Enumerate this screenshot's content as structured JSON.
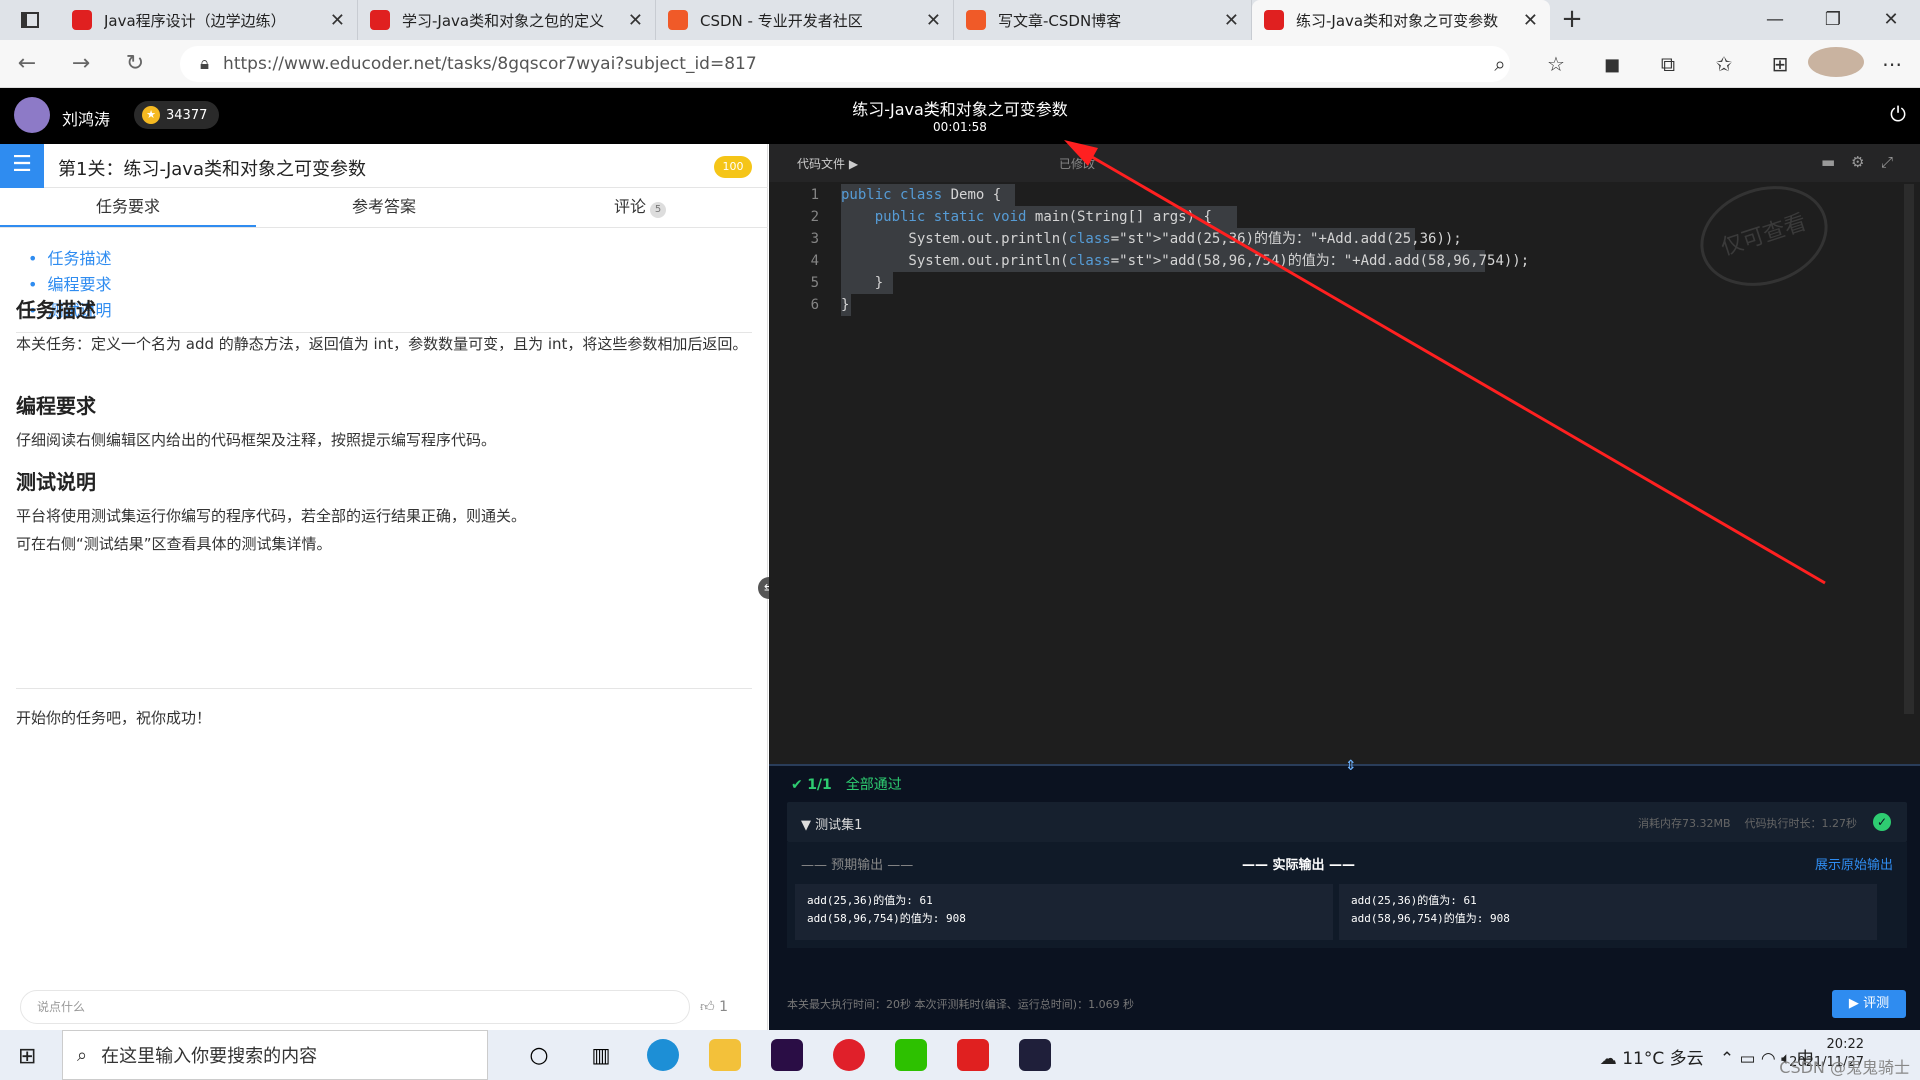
{
  "browser": {
    "tabs": [
      {
        "title": "Java程序设计（边学边练）",
        "favicon_color": "#e02020"
      },
      {
        "title": "学习-Java类和对象之包的定义",
        "favicon_color": "#e02020"
      },
      {
        "title": "CSDN - 专业开发者社区",
        "favicon_color": "#f05a28"
      },
      {
        "title": "写文章-CSDN博客",
        "favicon_color": "#f05a28"
      },
      {
        "title": "练习-Java类和对象之可变参数",
        "favicon_color": "#e02020",
        "active": true
      }
    ],
    "url": "https://www.educoder.net/tasks/8gqscor7wyai?subject_id=817"
  },
  "header": {
    "username": "刘鸿涛",
    "coins": "34377",
    "title": "练习-Java类和对象之可变参数",
    "timer": "00:01:58"
  },
  "left": {
    "level_title": "第1关：练习-Java类和对象之可变参数",
    "score": "100",
    "tabs": [
      "任务要求",
      "参考答案",
      "评论"
    ],
    "comment_count": "5",
    "toc": [
      "任务描述",
      "编程要求",
      "测试说明"
    ],
    "sections": {
      "task_heading": "任务描述",
      "task_text": "本关任务：定义一个名为 add 的静态方法，返回值为 int，参数数量可变，且为 int，将这些参数相加后返回。",
      "req_heading": "编程要求",
      "req_text": "仔细阅读右侧编辑区内给出的代码框架及注释，按照提示编写程序代码。",
      "test_heading": "测试说明",
      "test_text_1": "平台将使用测试集运行你编写的程序代码，若全部的运行结果正确，则通关。",
      "test_text_2": "可在右侧“测试结果”区查看具体的测试集详情。",
      "closing": "开始你的任务吧，祝你成功！"
    },
    "comment_placeholder": "说点什么",
    "likes": "1"
  },
  "editor": {
    "files_label": "代码文件",
    "modified_label": "已修改",
    "watermark": "仅可查看",
    "line_numbers": [
      "1",
      "2",
      "3",
      "4",
      "5",
      "6"
    ],
    "code_lines": [
      "public class Demo {",
      "    public static void main(String[] args) {",
      "        System.out.println(\"add(25,36)的值为：\"+Add.add(25,36));",
      "        System.out.println(\"add(58,96,754)的值为：\"+Add.add(58,96,754));",
      "    }",
      "}"
    ]
  },
  "results": {
    "pass_count": "1/1",
    "pass_text": "全部通过",
    "set_name": "测试集1",
    "memory": "消耗内存73.32MB",
    "exec_time": "代码执行时长：1.27秒",
    "expected_label": "—— 预期输出 ——",
    "actual_label": "—— 实际输出 ——",
    "show_raw": "展示原始输出",
    "expected_lines": [
      "add(25,36)的值为: 61",
      "add(58,96,754)的值为: 908"
    ],
    "actual_lines": [
      "add(25,36)的值为: 61",
      "add(58,96,754)的值为: 908"
    ],
    "footer": "本关最大执行时间：20秒    本次评测耗时(编译、运行总时间)：1.069 秒",
    "run_button": "评测"
  },
  "taskbar": {
    "search_placeholder": "在这里输入你要搜索的内容",
    "weather": "11°C 多云",
    "time": "20:22",
    "date": "2021/11/27",
    "ime": "中",
    "watermark_text": "CSDN @鬼鬼骑士"
  },
  "colors": {
    "accent": "#2f8cf0",
    "pass": "#2ecc71",
    "arrow": "#ff2020"
  }
}
